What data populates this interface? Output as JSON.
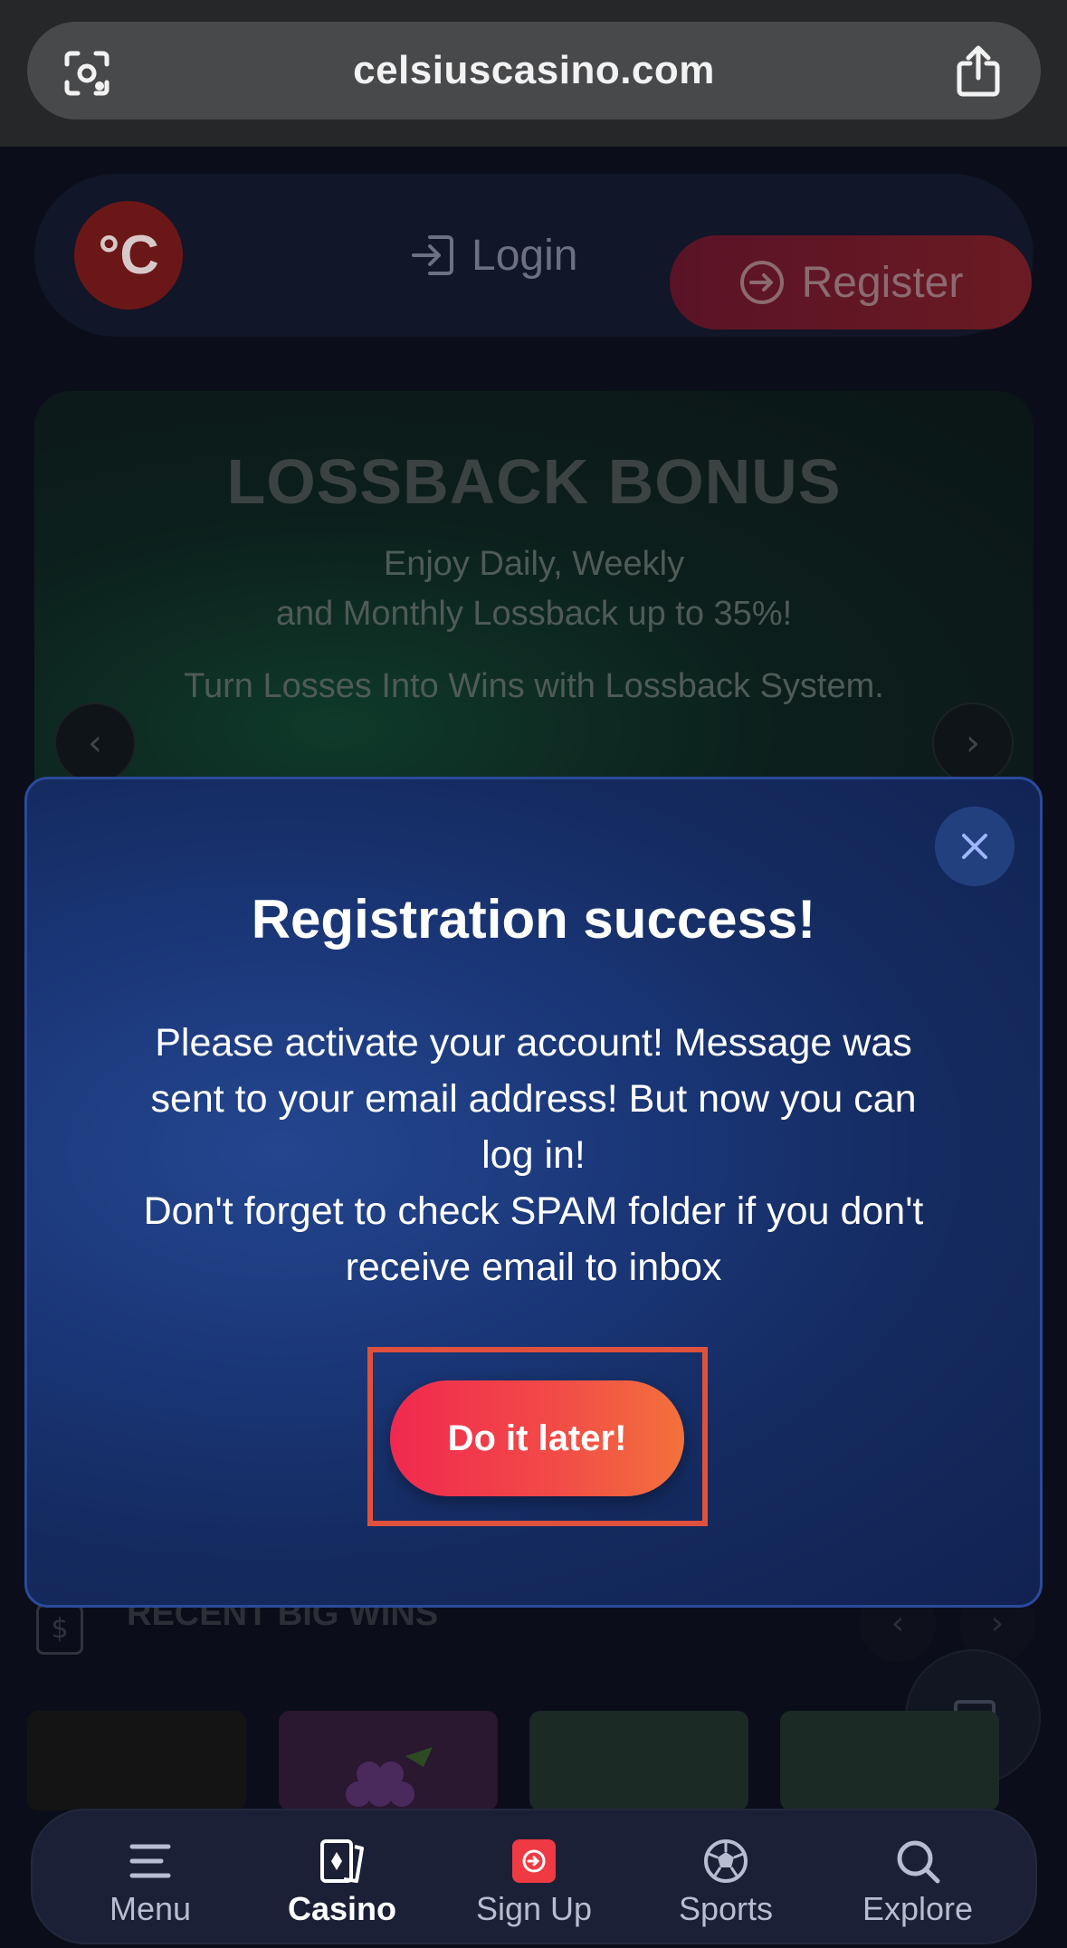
{
  "browser": {
    "url": "celsiuscasino.com",
    "left_icon": "page-scan-icon",
    "right_icon": "share-icon"
  },
  "header": {
    "logo_text": "°C",
    "login_label": "Login",
    "register_label": "Register"
  },
  "banner": {
    "title": "LOSSBACK BONUS",
    "line1": "Enjoy Daily, Weekly",
    "line2": "and Monthly Lossback up to 35%!",
    "line3": "Turn Losses Into Wins with Lossback System."
  },
  "recent": {
    "icon_text": "$",
    "title": "RECENT BIG WINS"
  },
  "modal": {
    "title": "Registration success!",
    "body_lines": [
      "Please activate your account! Message was",
      "sent to your email address! But now you can",
      "log in!",
      "Don't forget to check SPAM folder if you don't",
      "receive email to inbox"
    ],
    "button_label": "Do it later!"
  },
  "bottom_nav": {
    "items": [
      {
        "label": "Menu",
        "icon": "hamburger-icon"
      },
      {
        "label": "Casino",
        "icon": "cards-icon",
        "active": true
      },
      {
        "label": "Sign Up",
        "icon": "signup-icon"
      },
      {
        "label": "Sports",
        "icon": "soccer-ball-icon"
      },
      {
        "label": "Explore",
        "icon": "search-icon"
      }
    ]
  },
  "colors": {
    "accent_gradient_start": "#f0294f",
    "accent_gradient_end": "#f3713c",
    "modal_bg": "#1a3677",
    "highlight_border": "#e0513d"
  }
}
